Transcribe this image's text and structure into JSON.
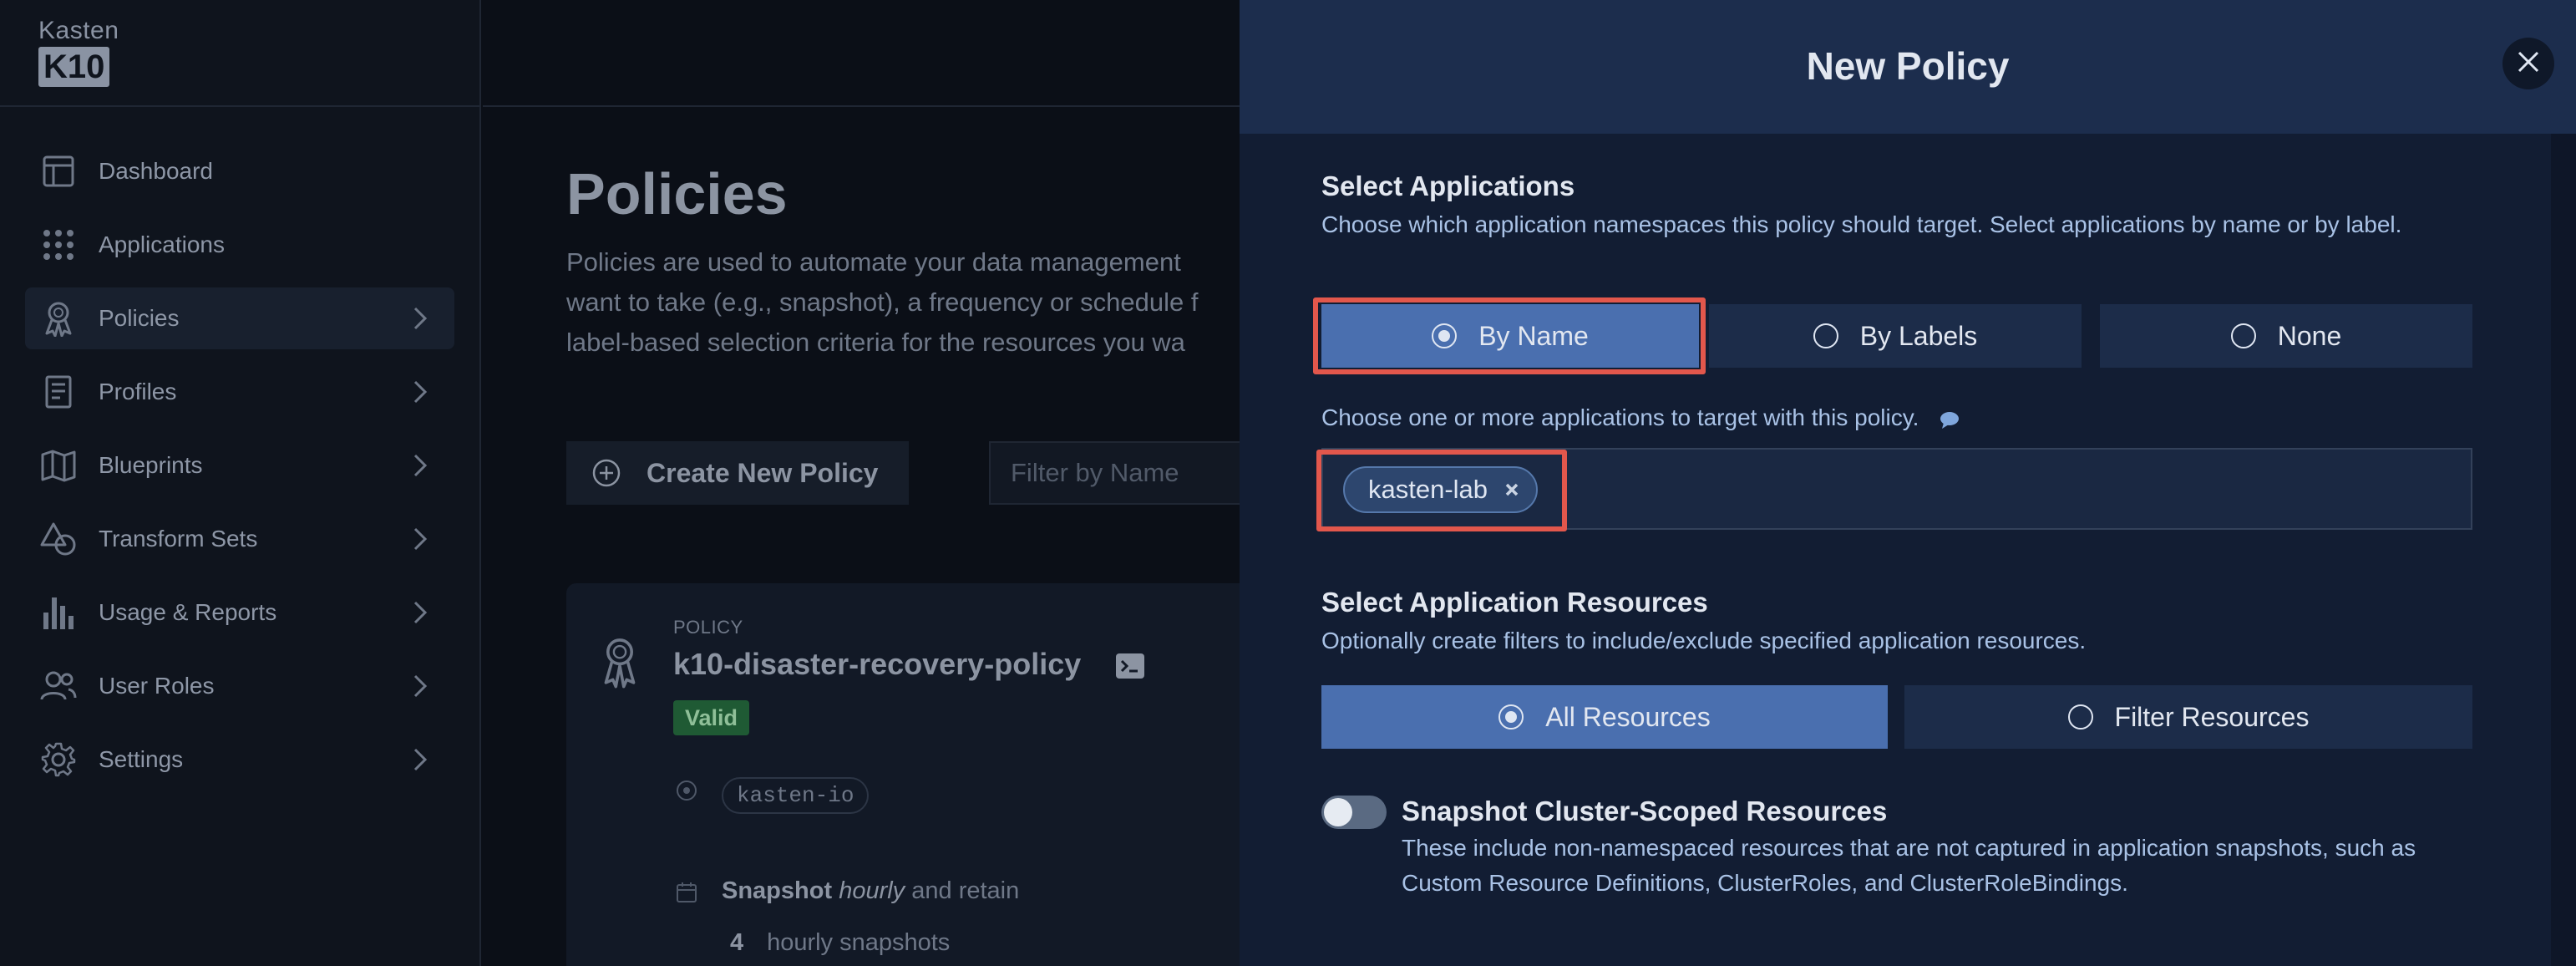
{
  "logo": {
    "brand": "Kasten",
    "product": "K10"
  },
  "sidebar": {
    "items": [
      {
        "label": "Dashboard",
        "icon": "dashboard-icon",
        "chevron": false,
        "active": false
      },
      {
        "label": "Applications",
        "icon": "grid-icon",
        "chevron": false,
        "active": false
      },
      {
        "label": "Policies",
        "icon": "ribbon-award-icon",
        "chevron": true,
        "active": true
      },
      {
        "label": "Profiles",
        "icon": "document-icon",
        "chevron": true,
        "active": false
      },
      {
        "label": "Blueprints",
        "icon": "map-icon",
        "chevron": true,
        "active": false
      },
      {
        "label": "Transform Sets",
        "icon": "shapes-icon",
        "chevron": true,
        "active": false
      },
      {
        "label": "Usage & Reports",
        "icon": "bar-chart-icon",
        "chevron": true,
        "active": false
      },
      {
        "label": "User Roles",
        "icon": "users-icon",
        "chevron": true,
        "active": false
      },
      {
        "label": "Settings",
        "icon": "gear-icon",
        "chevron": true,
        "active": false
      }
    ]
  },
  "main": {
    "title": "Policies",
    "description": "Policies are used to automate your data management\nwant to take (e.g., snapshot), a frequency or schedule f\nlabel-based selection criteria for the resources you wa",
    "create_button": "Create New Policy",
    "filter_placeholder": "Filter by Name",
    "policy_card": {
      "overline": "POLICY",
      "name": "k10-disaster-recovery-policy",
      "status": "Valid",
      "namespace": "kasten-io",
      "schedule_prefix": "Snapshot",
      "schedule_frequency": "hourly",
      "schedule_suffix": "and retain",
      "retain_count": "4",
      "retain_label": "hourly snapshots"
    }
  },
  "modal": {
    "title": "New Policy",
    "select_apps": {
      "title": "Select Applications",
      "description": "Choose which application namespaces this policy should target. Select applications by name or by label.",
      "options": [
        {
          "label": "By Name",
          "selected": true
        },
        {
          "label": "By Labels",
          "selected": false
        },
        {
          "label": "None",
          "selected": false
        }
      ],
      "apps_label": "Choose one or more applications to target with this policy.",
      "selected_apps": [
        "kasten-lab"
      ]
    },
    "select_resources": {
      "title": "Select Application Resources",
      "description": "Optionally create filters to include/exclude specified application resources.",
      "options": [
        {
          "label": "All Resources",
          "selected": true
        },
        {
          "label": "Filter Resources",
          "selected": false
        }
      ]
    },
    "cluster_scoped": {
      "title": "Snapshot Cluster-Scoped Resources",
      "description": "These include non-namespaced resources that are not captured in application snapshots, such as Custom Resource Definitions, ClusterRoles, and ClusterRoleBindings.",
      "enabled": false
    }
  },
  "colors": {
    "highlight": "#e2574c",
    "selected_segment": "#4a6faf",
    "panel_header": "#1c2d4d"
  }
}
